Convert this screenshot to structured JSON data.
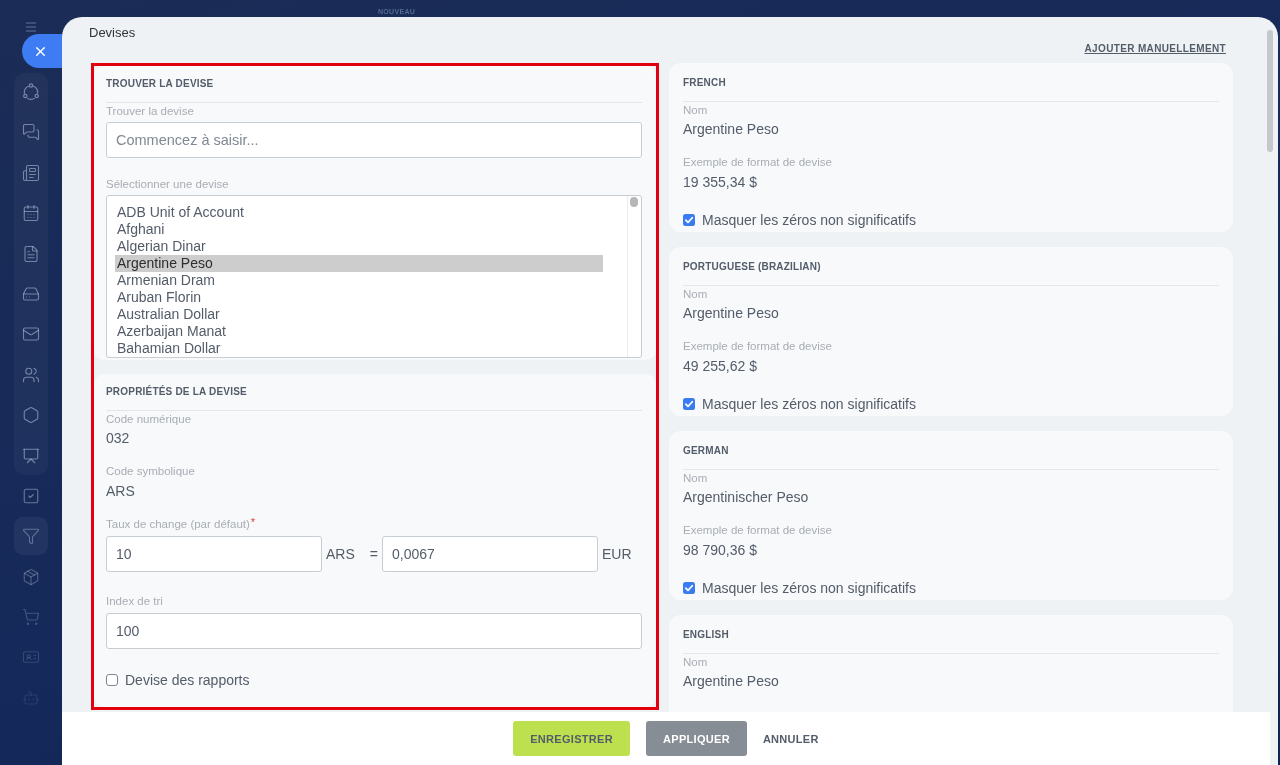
{
  "header_label": "NOUVEAU",
  "sidebar": {
    "items": [
      {
        "selected": false
      },
      {
        "selected": false
      },
      {
        "selected": false
      },
      {
        "selected": false
      },
      {
        "selected": false
      },
      {
        "selected": false
      },
      {
        "selected": false
      },
      {
        "selected": false
      },
      {
        "selected": false
      },
      {
        "selected": false
      },
      {
        "selected": false
      },
      {
        "selected": true
      },
      {
        "selected": false
      },
      {
        "selected": false
      },
      {
        "selected": false
      },
      {
        "selected": false
      }
    ]
  },
  "window": {
    "title": "Devises"
  },
  "add_manually_link": "AJOUTER MANUELLEMENT",
  "find_section": {
    "heading": "TROUVER LA DEVISE",
    "search": {
      "label": "Trouver la devise",
      "placeholder": "Commencez à saisir..."
    },
    "currency_list": {
      "label": "Sélectionner une devise",
      "items": [
        {
          "name": "ADB Unit of Account",
          "selected": false
        },
        {
          "name": "Afghani",
          "selected": false
        },
        {
          "name": "Algerian Dinar",
          "selected": false
        },
        {
          "name": "Argentine Peso",
          "selected": true
        },
        {
          "name": "Armenian Dram",
          "selected": false
        },
        {
          "name": "Aruban Florin",
          "selected": false
        },
        {
          "name": "Australian Dollar",
          "selected": false
        },
        {
          "name": "Azerbaijan Manat",
          "selected": false
        },
        {
          "name": "Bahamian Dollar",
          "selected": false
        }
      ]
    }
  },
  "properties": {
    "heading": "PROPRIÉTÉS DE LA DEVISE",
    "numeric_code": {
      "label": "Code numérique",
      "value": "032"
    },
    "symbolic_code": {
      "label": "Code symbolique",
      "value": "ARS"
    },
    "exchange_rate": {
      "label": "Taux de change (par défaut)",
      "required_mark": "*",
      "amount": "10",
      "unit": "ARS",
      "equals": "=",
      "rate": "0,0067",
      "base_unit": "EUR"
    },
    "sort_index": {
      "label": "Index de tri",
      "value": "100"
    },
    "report_currency": {
      "label": "Devise des rapports",
      "checked": false
    }
  },
  "translations": [
    {
      "heading": "FRENCH",
      "name_label": "Nom",
      "name": "Argentine Peso",
      "format_label": "Exemple de format de devise",
      "format_sample": "19 355,34 $",
      "hide_zeros": {
        "label": "Masquer les zéros non significatifs",
        "checked": true
      }
    },
    {
      "heading": "PORTUGUESE (BRAZILIAN)",
      "name_label": "Nom",
      "name": "Argentine Peso",
      "format_label": "Exemple de format de devise",
      "format_sample": "49 255,62 $",
      "hide_zeros": {
        "label": "Masquer les zéros non significatifs",
        "checked": true
      }
    },
    {
      "heading": "GERMAN",
      "name_label": "Nom",
      "name": "Argentinischer Peso",
      "format_label": "Exemple de format de devise",
      "format_sample": "98 790,36 $",
      "hide_zeros": {
        "label": "Masquer les zéros non significatifs",
        "checked": true
      }
    },
    {
      "heading": "ENGLISH",
      "name_label": "Nom",
      "name": "Argentine Peso"
    }
  ],
  "footer": {
    "buttons": [
      {
        "label": "ENREGISTRER",
        "kind": "primary"
      },
      {
        "label": "APPLIQUER",
        "kind": "secondary"
      },
      {
        "label": "ANNULER",
        "kind": "link"
      }
    ]
  }
}
